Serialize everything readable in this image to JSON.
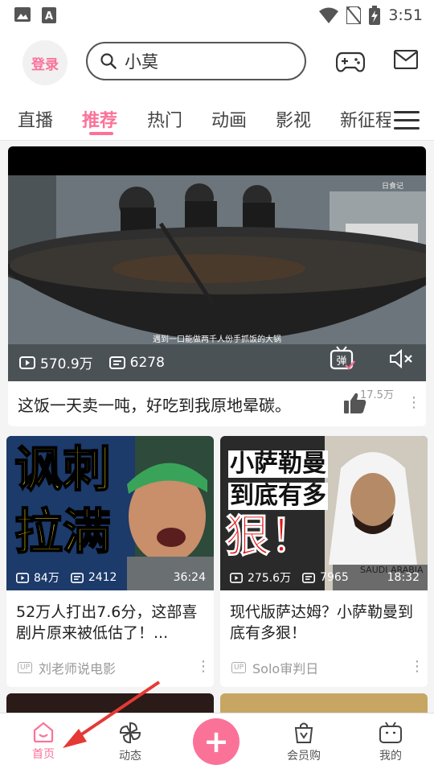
{
  "status_bar": {
    "time": "3:51",
    "icons": [
      "image-icon",
      "text-icon",
      "wifi-icon",
      "no-sim-icon",
      "battery-charging-icon"
    ]
  },
  "header": {
    "login_label": "登录",
    "search_value": "小莫",
    "icons": [
      "game-controller-icon",
      "mail-icon"
    ]
  },
  "tabs": [
    "直播",
    "推荐",
    "热门",
    "动画",
    "影视",
    "新征程"
  ],
  "active_tab": "推荐",
  "featured": {
    "views": "570.9万",
    "danmaku": "6278",
    "subtitle": "遇到一口能做两千人份手抓饭的大锅",
    "title": "这饭一天卖一吨，好吃到我原地晕碳。",
    "likes": "17.5万",
    "watermark": "日食记"
  },
  "cards": [
    {
      "thumb_text_1": "讽刺",
      "thumb_text_2": "拉满",
      "views": "84万",
      "danmaku": "2412",
      "duration": "36:24",
      "title": "52万人打出7.6分，这部喜剧片原来被低估了！...",
      "author": "刘老师说电影",
      "up_label": "UP"
    },
    {
      "thumb_text_1": "小萨勒曼",
      "thumb_text_2": "到底有多",
      "thumb_text_3": "狠！",
      "banner": "SAUDI ARABIA",
      "views": "275.6万",
      "danmaku": "7965",
      "duration": "18:32",
      "title": "现代版萨达姆？小萨勒曼到底有多狠！",
      "author": "Solo审判日",
      "up_label": "UP"
    }
  ],
  "bottom_nav": [
    {
      "label": "首页",
      "icon": "home-icon"
    },
    {
      "label": "动态",
      "icon": "pinwheel-icon"
    },
    {
      "label": "+",
      "icon": "plus-icon"
    },
    {
      "label": "会员购",
      "icon": "shopping-bag-icon"
    },
    {
      "label": "我的",
      "icon": "tv-face-icon"
    }
  ],
  "colors": {
    "accent": "#fb7299",
    "text": "#212121",
    "secondary": "#999999"
  }
}
